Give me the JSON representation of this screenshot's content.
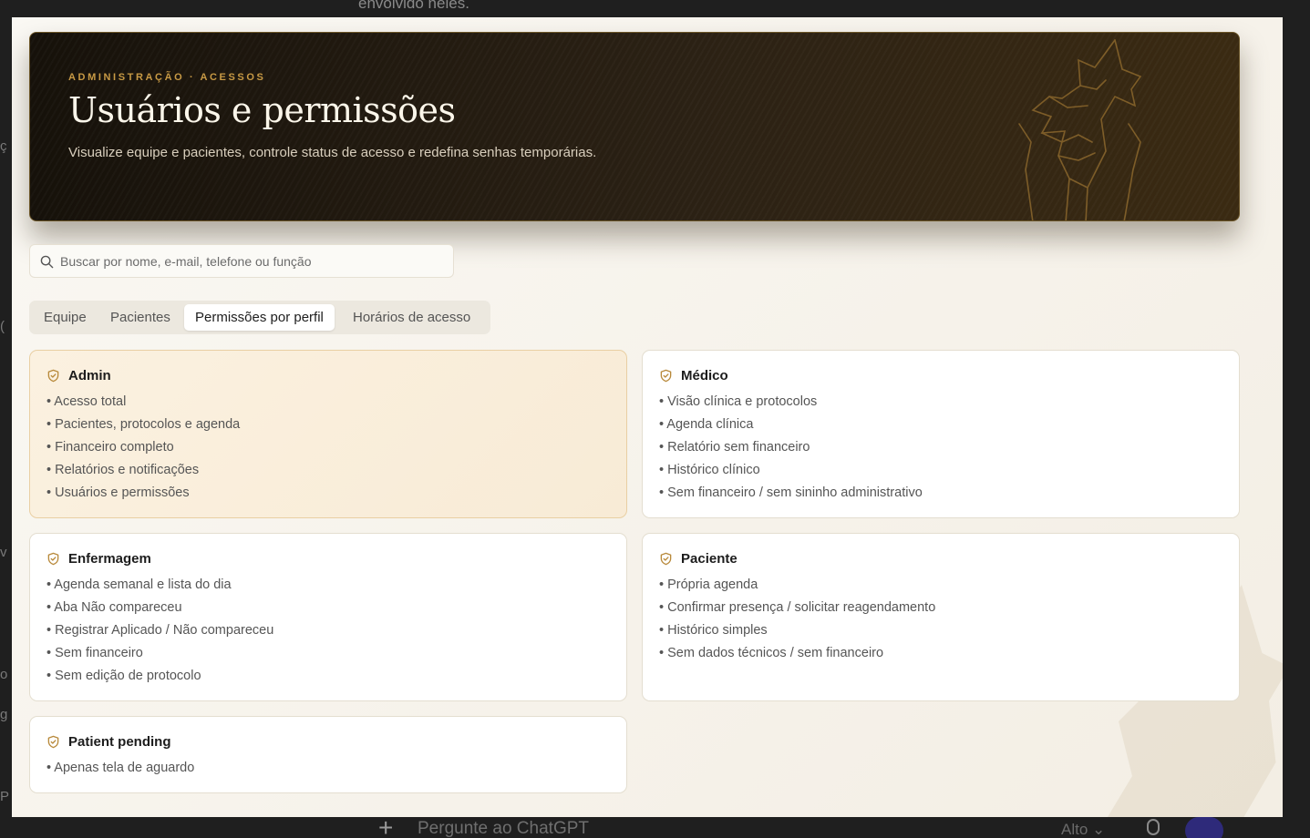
{
  "background": {
    "top_text": "envolvido neles.",
    "composer_placeholder": "Pergunte ao ChatGPT",
    "model_label": "Alto ⌄"
  },
  "hero": {
    "eyebrow": "ADMINISTRAÇÃO · ACESSOS",
    "title": "Usuários e permissões",
    "subtitle": "Visualize equipe e pacientes, controle status de acesso e redefina senhas temporárias."
  },
  "search": {
    "placeholder": "Buscar por nome, e-mail, telefone ou função",
    "value": ""
  },
  "tabs": [
    {
      "label": "Equipe",
      "active": false
    },
    {
      "label": "Pacientes",
      "active": false
    },
    {
      "label": "Permissões por perfil",
      "active": true
    },
    {
      "label": "Horários de acesso",
      "active": false
    }
  ],
  "profiles": [
    {
      "title": "Admin",
      "highlighted": true,
      "permissions": [
        "• Acesso total",
        "• Pacientes, protocolos e agenda",
        "• Financeiro completo",
        "• Relatórios e notificações",
        "• Usuários e permissões"
      ]
    },
    {
      "title": "Médico",
      "highlighted": false,
      "permissions": [
        "• Visão clínica e protocolos",
        "• Agenda clínica",
        "• Relatório sem financeiro",
        "• Histórico clínico",
        "• Sem financeiro / sem sininho administrativo"
      ]
    },
    {
      "title": "Enfermagem",
      "highlighted": false,
      "permissions": [
        "• Agenda semanal e lista do dia",
        "• Aba Não compareceu",
        "• Registrar Aplicado / Não compareceu",
        "• Sem financeiro",
        "• Sem edição de protocolo"
      ]
    },
    {
      "title": "Paciente",
      "highlighted": false,
      "permissions": [
        "• Própria agenda",
        "• Confirmar presença / solicitar reagendamento",
        "• Histórico simples",
        "• Sem dados técnicos / sem financeiro"
      ]
    },
    {
      "title": "Patient pending",
      "highlighted": false,
      "permissions": [
        "• Apenas tela de aguardo"
      ]
    }
  ],
  "colors": {
    "accent_gold": "#c89a45",
    "hero_dark": "#16110a",
    "admin_card_bg": "#fbf1e0"
  }
}
